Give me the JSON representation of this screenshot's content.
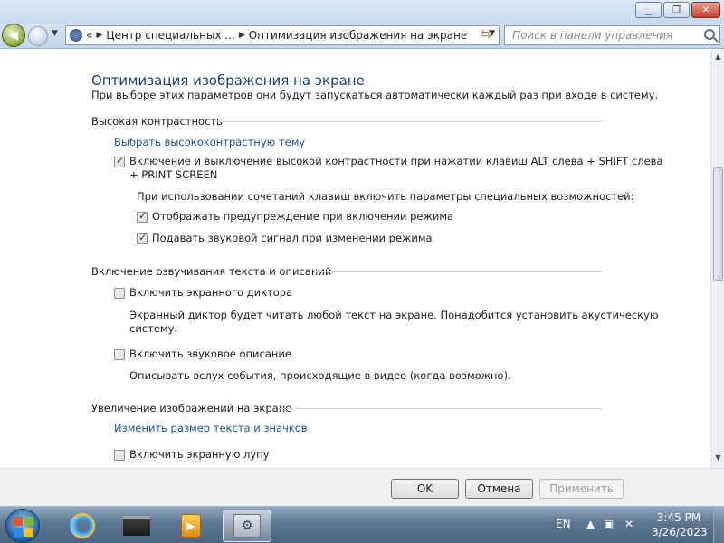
{
  "window": {
    "minimize_label": "▁",
    "maximize_label": "❐",
    "close_label": "✕"
  },
  "address": {
    "prefix": "«",
    "crumbs": [
      "Центр специальных ...",
      "Оптимизация изображения на экране"
    ],
    "search_placeholder": "Поиск в панели управления"
  },
  "page": {
    "title": "Оптимизация изображения на экране",
    "subtitle": "При выборе этих параметров они будут запускаться автоматически каждый раз при входе в систему.",
    "sections": [
      {
        "title": "Высокая контрастность",
        "link": "Выбрать высококонтрастную тему",
        "toggle_label_line1": "Включение и выключение высокой контрастности при нажатии клавиш ALT слева + SHIFT слева",
        "toggle_label_line2": "+ PRINT SCREEN",
        "toggle_checked": true,
        "shortcut_caption": "При использовании сочетаний клавиш включить параметры специальных возможностей:",
        "options": [
          {
            "label": "Отображать предупреждение при включении режима",
            "checked": true
          },
          {
            "label": "Подавать звуковой сигнал при изменении режима",
            "checked": true
          }
        ]
      },
      {
        "title": "Включение озвучивания текста и описаний",
        "narrator_label": "Включить экранного диктора",
        "narrator_checked": false,
        "narrator_desc_line1": "Экранный диктор будет читать любой текст на экране. Понадобится установить акустическую",
        "narrator_desc_line2": "систему.",
        "audio_label": "Включить звуковое описание",
        "audio_checked": false,
        "audio_desc": "Описывать вслух события, происходящие в видео (когда возможно)."
      },
      {
        "title": "Увеличение изображений на экране",
        "link": "Изменить размер текста и значков",
        "magnifier_label": "Включить экранную лупу",
        "magnifier_checked": false
      }
    ]
  },
  "buttons": {
    "ok": "OK",
    "cancel": "Отмена",
    "apply": "Применить"
  },
  "taskbar": {
    "language": "EN",
    "time": "3:45 PM",
    "date": "3/26/2023"
  }
}
